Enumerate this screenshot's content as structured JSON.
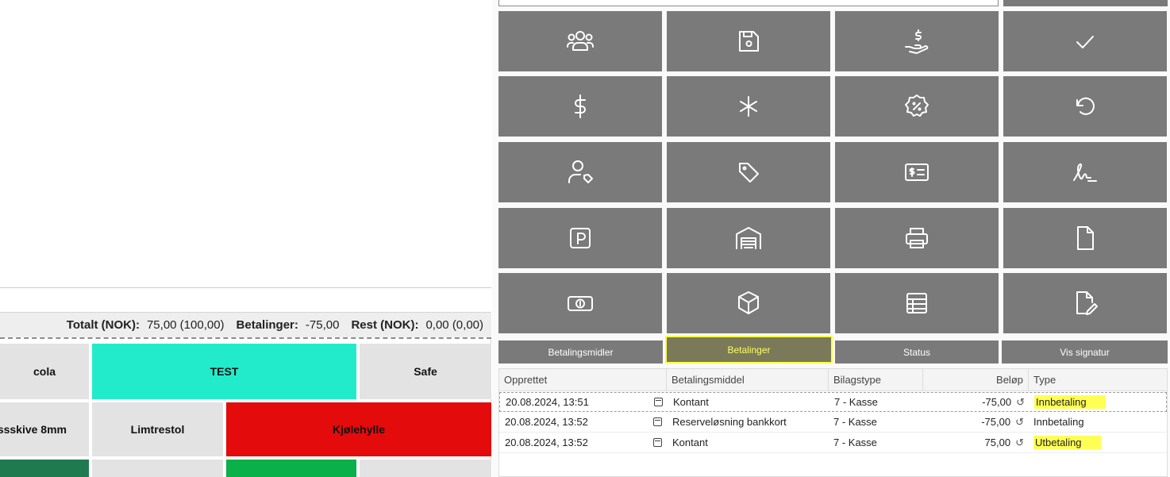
{
  "totals": {
    "total_label": "Totalt (NOK):",
    "total_value": "75,00 (100,00)",
    "payments_label": "Betalinger:",
    "payments_value": "-75,00",
    "rest_label": "Rest (NOK):",
    "rest_value": "0,00 (0,00)"
  },
  "products": {
    "row1": [
      "cola",
      "TEST",
      "Safe"
    ],
    "row2": [
      "ssskive 8mm",
      "Limtrestol",
      "Kjølehylle"
    ]
  },
  "function_buttons": [
    "customers-icon",
    "save-icon",
    "payment-hand-icon",
    "check-icon",
    "dollar-icon",
    "asterisk-icon",
    "discount-badge-icon",
    "undo-icon",
    "user-tag-icon",
    "tag-icon",
    "id-card-icon",
    "signature-icon",
    "parking-icon",
    "garage-icon",
    "printer-icon",
    "document-icon",
    "banknote-icon",
    "box-icon",
    "table-icon",
    "edit-document-icon"
  ],
  "tabs": [
    "Betalingsmidler",
    "Betalinger",
    "Status",
    "Vis signatur"
  ],
  "active_tab": "Betalinger",
  "grid": {
    "headers": [
      "Opprettet",
      "Betalingsmiddel",
      "Bilagstype",
      "Beløp",
      "Type"
    ],
    "rows": [
      {
        "created": "20.08.2024, 13:51",
        "method": "Kontant",
        "voucher": "7 - Kasse",
        "amount": "-75,00",
        "type": "Innbetaling"
      },
      {
        "created": "20.08.2024, 13:52",
        "method": "Reserveløsning bankkort",
        "voucher": "7 - Kasse",
        "amount": "-75,00",
        "type": "Innbetaling"
      },
      {
        "created": "20.08.2024, 13:52",
        "method": "Kontant",
        "voucher": "7 - Kasse",
        "amount": "75,00",
        "type": "Utbetaling"
      }
    ]
  },
  "colors": {
    "button_gray": "#7a7a7a",
    "teal": "#22ebcb",
    "red": "#e30b0b",
    "green_dark": "#1f7a4f",
    "green": "#0ab04a",
    "highlight": "#ffff55"
  }
}
